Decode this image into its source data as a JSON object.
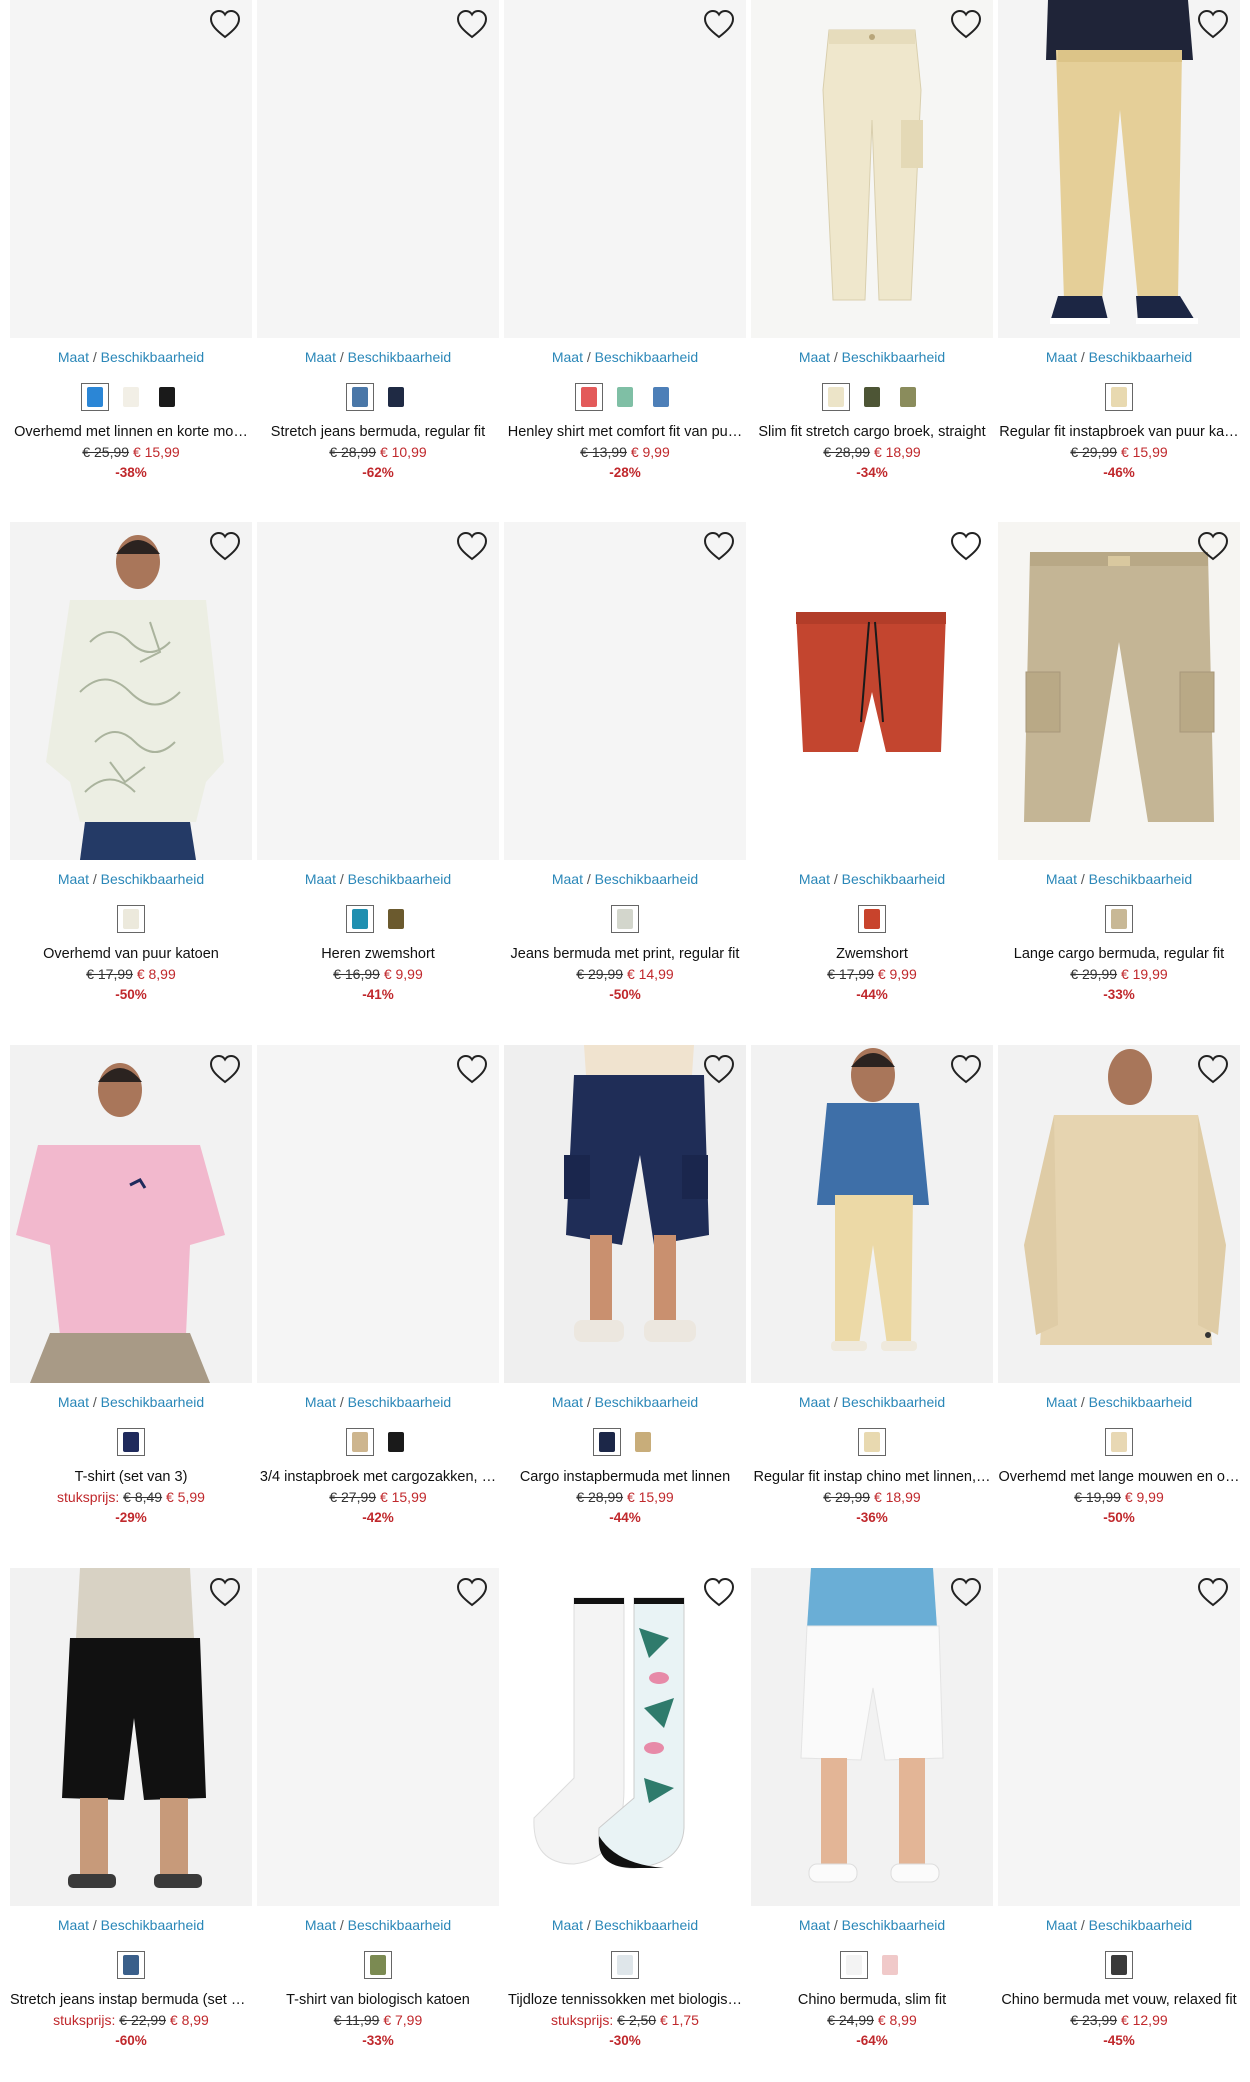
{
  "common": {
    "maat_label": "Maat",
    "beschik_label": "Beschikbaarheid",
    "sep": " / "
  },
  "products": [
    {
      "name": "Overhemd met linnen en korte mo…",
      "old": "€ 25,99",
      "new": "€ 15,99",
      "discount": "-38%",
      "prefix": "",
      "image": "none",
      "swatches": [
        "#2b86d6",
        "#f2efe6",
        "#1a1a1a"
      ]
    },
    {
      "name": "Stretch jeans bermuda, regular fit",
      "old": "€ 28,99",
      "new": "€ 10,99",
      "discount": "-62%",
      "prefix": "",
      "image": "none",
      "swatches": [
        "#4a77a8",
        "#1f2a44"
      ]
    },
    {
      "name": "Henley shirt met comfort fit van pu…",
      "old": "€ 13,99",
      "new": "€ 9,99",
      "discount": "-28%",
      "prefix": "",
      "image": "none",
      "swatches": [
        "#e35a5a",
        "#7fbfa5",
        "#4d7fb8"
      ]
    },
    {
      "name": "Slim fit stretch cargo broek, straight",
      "old": "€ 28,99",
      "new": "€ 18,99",
      "discount": "-34%",
      "prefix": "",
      "image": "pants",
      "swatches": [
        "#ece4c8",
        "#4d5535",
        "#8a8c5c"
      ]
    },
    {
      "name": "Regular fit instapbroek van puur ka…",
      "old": "€ 29,99",
      "new": "€ 15,99",
      "discount": "-46%",
      "prefix": "",
      "image": "pants-model",
      "swatches": [
        "#e8d9b0"
      ]
    },
    {
      "name": "Overhemd van puur katoen",
      "old": "€ 17,99",
      "new": "€ 8,99",
      "discount": "-50%",
      "prefix": "",
      "image": "shirt-model",
      "swatches": [
        "#ece9dc"
      ]
    },
    {
      "name": "Heren zwemshort",
      "old": "€ 16,99",
      "new": "€ 9,99",
      "discount": "-41%",
      "prefix": "",
      "image": "none",
      "swatches": [
        "#1f8fb0",
        "#6b5a2e"
      ]
    },
    {
      "name": "Jeans bermuda met print, regular fit",
      "old": "€ 29,99",
      "new": "€ 14,99",
      "discount": "-50%",
      "prefix": "",
      "image": "none",
      "swatches": [
        "#d3d6cc"
      ]
    },
    {
      "name": "Zwemshort",
      "old": "€ 17,99",
      "new": "€ 9,99",
      "discount": "-44%",
      "prefix": "",
      "image": "swimshort",
      "swatches": [
        "#c8432c"
      ]
    },
    {
      "name": "Lange cargo bermuda, regular fit",
      "old": "€ 29,99",
      "new": "€ 19,99",
      "discount": "-33%",
      "prefix": "",
      "image": "cargo-shorts",
      "swatches": [
        "#c8b896"
      ]
    },
    {
      "name": "T-shirt (set van 3)",
      "old": "€ 8,49",
      "new": "€ 5,99",
      "discount": "-29%",
      "prefix": "stuksprijs:",
      "image": "tshirt-model",
      "swatches": [
        "#1f2a5c"
      ]
    },
    {
      "name": "3/4 instapbroek met cargozakken, …",
      "old": "€ 27,99",
      "new": "€ 15,99",
      "discount": "-42%",
      "prefix": "",
      "image": "none",
      "swatches": [
        "#cdb58e",
        "#1a1a1a"
      ]
    },
    {
      "name": "Cargo instapbermuda met linnen",
      "old": "€ 28,99",
      "new": "€ 15,99",
      "discount": "-44%",
      "prefix": "",
      "image": "cargo-model",
      "swatches": [
        "#1c2748",
        "#c8ad7a"
      ]
    },
    {
      "name": "Regular fit instap chino met linnen,…",
      "old": "€ 29,99",
      "new": "€ 18,99",
      "discount": "-36%",
      "prefix": "",
      "image": "chino-model",
      "swatches": [
        "#e8d9b0"
      ]
    },
    {
      "name": "Overhemd met lange mouwen en o…",
      "old": "€ 19,99",
      "new": "€ 9,99",
      "discount": "-50%",
      "prefix": "",
      "image": "overshirt-model",
      "swatches": [
        "#e8d8b4"
      ]
    },
    {
      "name": "Stretch jeans instap bermuda (set v…",
      "old": "€ 22,99",
      "new": "€ 8,99",
      "discount": "-60%",
      "prefix": "stuksprijs:",
      "image": "black-shorts",
      "swatches": [
        "#3a5f8a"
      ]
    },
    {
      "name": "T-shirt van biologisch katoen",
      "old": "€ 11,99",
      "new": "€ 7,99",
      "discount": "-33%",
      "prefix": "",
      "image": "none",
      "swatches": [
        "#7b8a52"
      ]
    },
    {
      "name": "Tijdloze tennissokken met biologis…",
      "old": "€ 2,50",
      "new": "€ 1,75",
      "discount": "-30%",
      "prefix": "stuksprijs:",
      "image": "socks",
      "swatches": [
        "#dfe6ea"
      ]
    },
    {
      "name": "Chino bermuda, slim fit",
      "old": "€ 24,99",
      "new": "€ 8,99",
      "discount": "-64%",
      "prefix": "",
      "image": "white-shorts",
      "swatches": [
        "#f3f3f3",
        "#f0c9c9"
      ]
    },
    {
      "name": "Chino bermuda met vouw, relaxed fit",
      "old": "€ 23,99",
      "new": "€ 12,99",
      "discount": "-45%",
      "prefix": "",
      "image": "none",
      "swatches": [
        "#3a3a3a"
      ]
    }
  ]
}
